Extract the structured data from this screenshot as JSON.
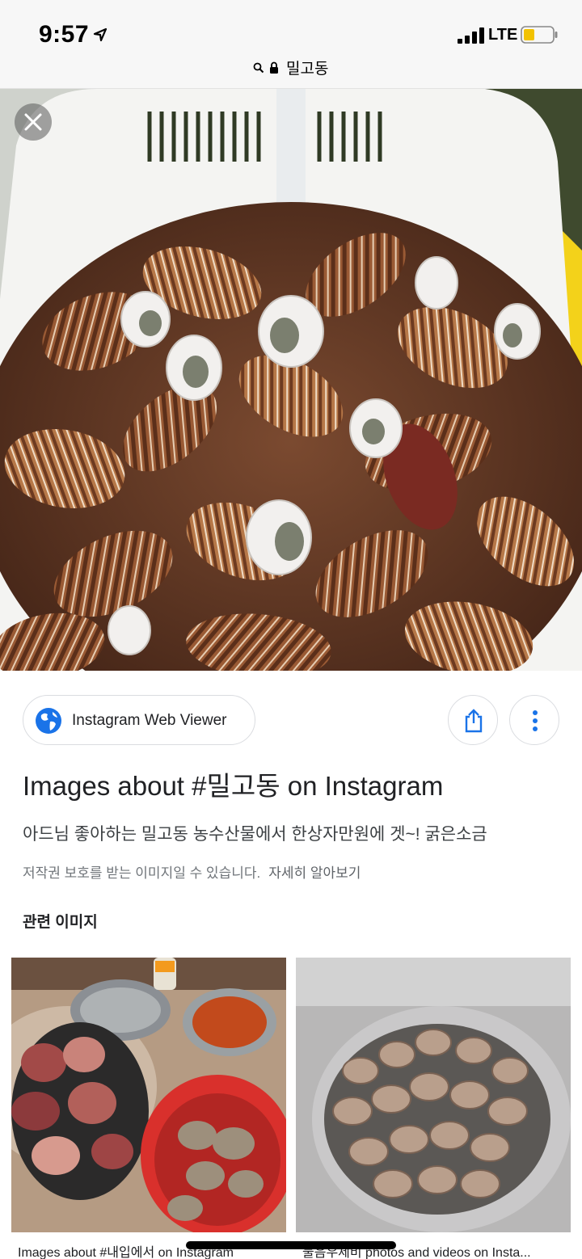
{
  "status_bar": {
    "time": "9:57",
    "network": "LTE"
  },
  "browser": {
    "url_text": "밀고동"
  },
  "source": {
    "name": "Instagram Web Viewer"
  },
  "result": {
    "title": "Images about #밀고동 on Instagram",
    "description": "아드님 좋아하는 밀고동 농수산물에서 한상자만원에 겟~! 굵은소금",
    "copyright_notice": "저작권 보호를 받는 이미지일 수 있습니다.",
    "learn_more": "자세히 알아보기"
  },
  "related_images": {
    "heading": "관련 이미지",
    "items": [
      {
        "caption": "Images about #내입에서 on Instagram"
      },
      {
        "caption": "물음우제비 photos and videos on Insta..."
      }
    ]
  },
  "colors": {
    "accent_blue": "#1a73e8",
    "text_primary": "#202124",
    "text_secondary": "#70757a"
  }
}
